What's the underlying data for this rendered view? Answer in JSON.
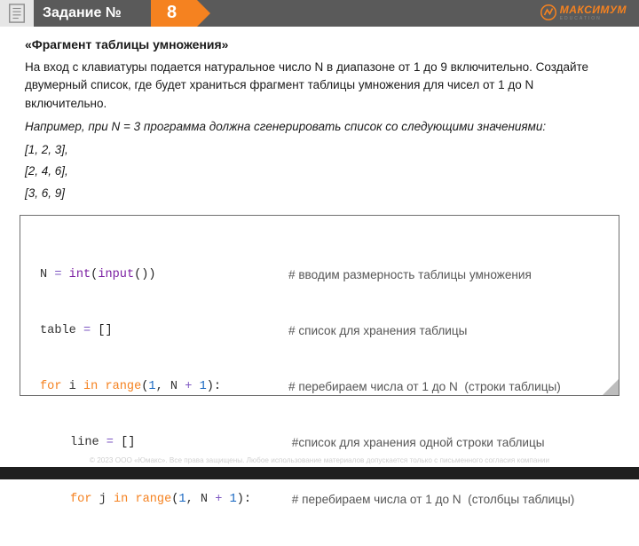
{
  "header": {
    "title": "Задание №",
    "task_number": "8",
    "logo_text": "МАКСИМУМ",
    "logo_sub": "EDUCATION"
  },
  "body": {
    "title": "«Фрагмент таблицы умножения»",
    "p1": "На вход с клавиатуры подается натуральное число N в диапазоне от 1 до 9 включительно. Создайте двумерный список, где будет храниться фрагмент таблицы умножения для чисел от 1 до N включительно.",
    "p2": "Например, при N = 3 программа должна сгенерировать список со следующими значениями:",
    "examples": [
      "[1, 2, 3],",
      "[2, 4, 6],",
      "[3, 6, 9]"
    ]
  },
  "code": {
    "l1_code": {
      "a": "N ",
      "b": "= ",
      "c": "int",
      "d": "(",
      "e": "input",
      "f": "())"
    },
    "l1_cm": "# вводим размерность таблицы умножения",
    "l2_code": {
      "a": "table ",
      "b": "= ",
      "c": "[]"
    },
    "l2_cm": "# список для хранения таблицы",
    "l3_code": {
      "a": "for ",
      "b": "i ",
      "c": "in ",
      "d": "range",
      "e": "(",
      "f": "1",
      "g": ", N ",
      "h": "+ ",
      "i": "1",
      "j": "):"
    },
    "l3_cm": "# перебираем числа от 1 до N  (строки таблицы)",
    "l4_code": {
      "a": "line ",
      "b": "= ",
      "c": "[]"
    },
    "l4_cm": " #список для хранения одной строки таблицы",
    "l5_code": {
      "a": "for ",
      "b": "j ",
      "c": "in ",
      "d": "range",
      "e": "(",
      "f": "1",
      "g": ", N ",
      "h": "+ ",
      "i": "1",
      "j": "):"
    },
    "l5_cm": " # перебираем числа от 1 до N  (столбцы таблицы)"
  },
  "footer": "© 2023 ООО «Юмакс». Все права защищены. Любое использование материалов допускается только с письменного согласия компании"
}
